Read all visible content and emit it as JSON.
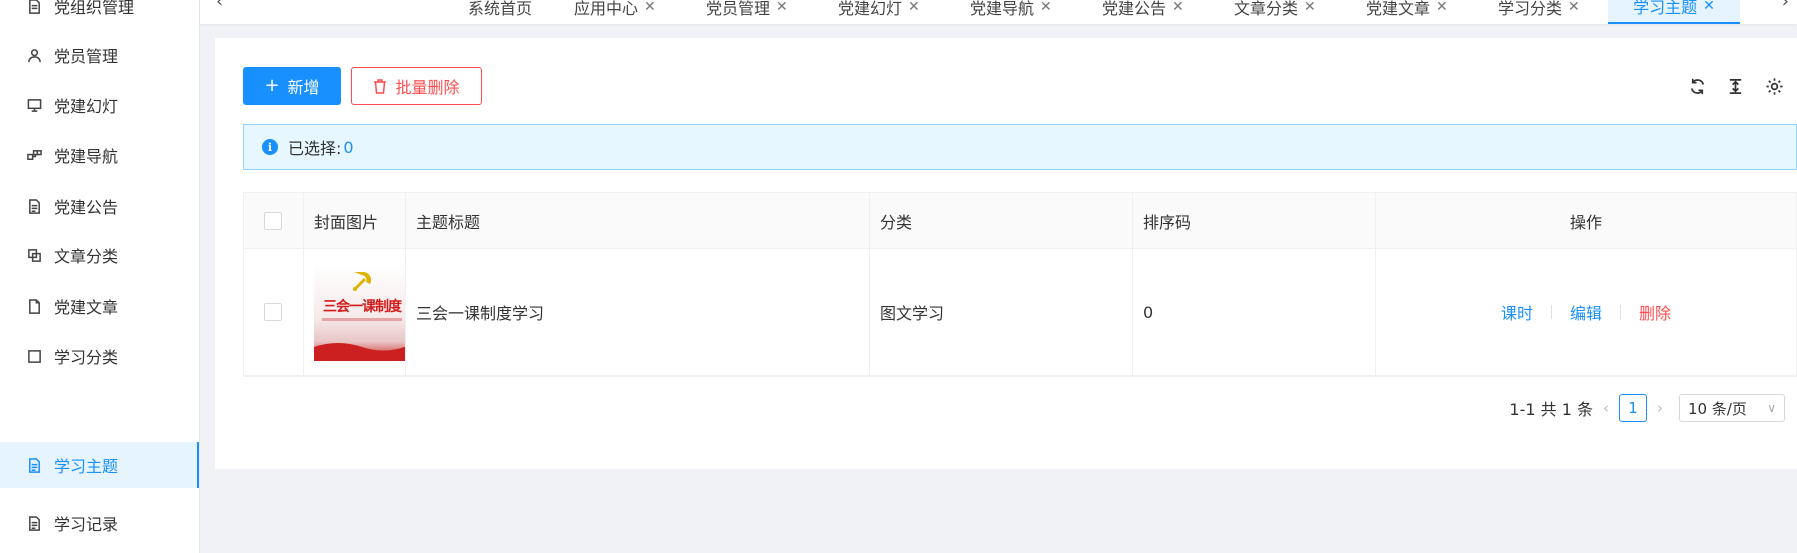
{
  "sidebar": {
    "items": [
      {
        "label": "党组织管理",
        "icon": "file-icon"
      },
      {
        "label": "党员管理",
        "icon": "user-icon"
      },
      {
        "label": "党建幻灯",
        "icon": "monitor-icon"
      },
      {
        "label": "党建导航",
        "icon": "nodes-icon"
      },
      {
        "label": "党建公告",
        "icon": "file-text-icon"
      },
      {
        "label": "文章分类",
        "icon": "copy-icon"
      },
      {
        "label": "党建文章",
        "icon": "file-icon"
      },
      {
        "label": "学习分类",
        "icon": "square-icon"
      },
      {
        "label": "学习主题",
        "icon": "file-text-icon",
        "active": true
      },
      {
        "label": "学习记录",
        "icon": "file-text-icon"
      }
    ]
  },
  "tabs": [
    {
      "label": "系统首页",
      "closable": false
    },
    {
      "label": "应用中心",
      "closable": true
    },
    {
      "label": "党员管理",
      "closable": true
    },
    {
      "label": "党建幻灯",
      "closable": true
    },
    {
      "label": "党建导航",
      "closable": true
    },
    {
      "label": "党建公告",
      "closable": true
    },
    {
      "label": "文章分类",
      "closable": true
    },
    {
      "label": "党建文章",
      "closable": true
    },
    {
      "label": "学习分类",
      "closable": true
    },
    {
      "label": "学习主题",
      "closable": true,
      "active": true
    }
  ],
  "toolbar": {
    "add_label": "新增",
    "batch_delete_label": "批量删除"
  },
  "alert": {
    "prefix": "已选择:",
    "count": "0"
  },
  "table": {
    "columns": [
      "封面图片",
      "主题标题",
      "分类",
      "排序码",
      "操作"
    ],
    "rows": [
      {
        "cover_text": "三会一课制度",
        "title": "三会一课制度学习",
        "category": "图文学习",
        "sort": "0",
        "actions": [
          "课时",
          "编辑",
          "删除"
        ]
      }
    ]
  },
  "pagination": {
    "summary": "1-1 共 1 条",
    "current": "1",
    "page_size": "10 条/页"
  },
  "colors": {
    "primary": "#1890ff",
    "danger": "#ff4d4f",
    "active_bg": "#e6f4ff"
  }
}
